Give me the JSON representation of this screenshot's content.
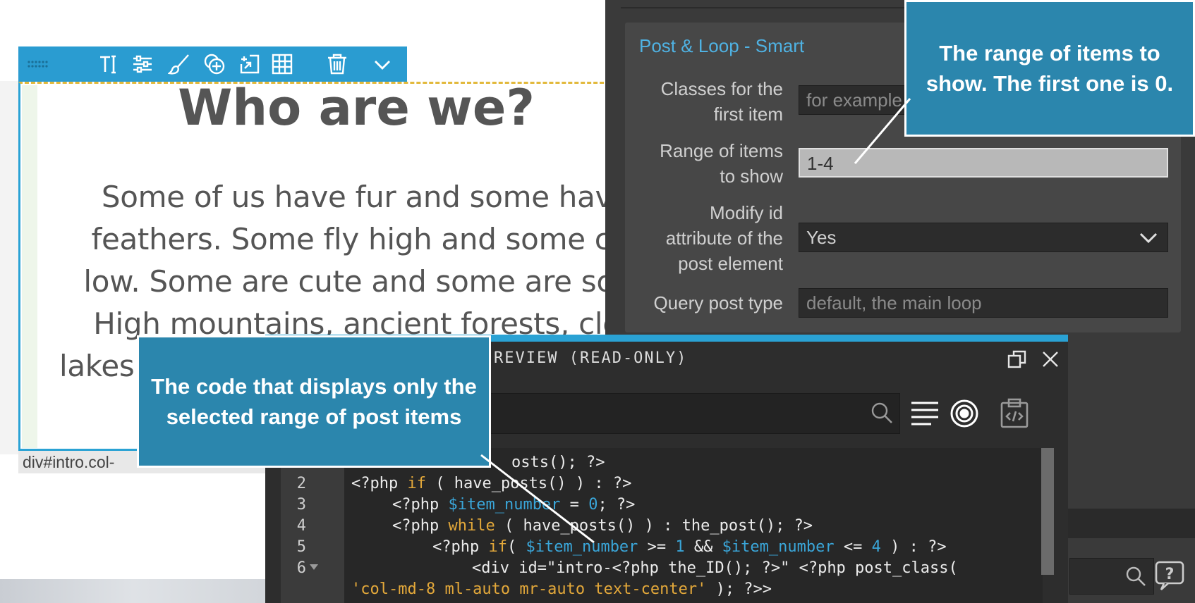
{
  "canvas": {
    "heading": "Who are we?",
    "body_lines": [
      "Some of us have fur and some hav",
      "feathers. Some fly high and some cr",
      "low. Some are cute and some are sca",
      "High mountains, ancient forests, cle",
      "lakes"
    ],
    "breadcrumb": "div#intro.col-",
    "toolbar_icons": [
      "drag-handle-icon",
      "text-icon",
      "sliders-icon",
      "brush-icon",
      "add-element-icon",
      "insert-icon",
      "grid-icon",
      "trash-icon",
      "chevron-down-icon"
    ]
  },
  "settings_panel": {
    "group_title": "Post & Loop - Smart",
    "fields": {
      "classes_first_item": {
        "label_line1": "Classes for the",
        "label_line2": "first item",
        "placeholder": "for example"
      },
      "range_of_items": {
        "label_line1": "Range of items",
        "label_line2": "to show",
        "value": "1-4"
      },
      "modify_id": {
        "label_line1": "Modify id",
        "label_line2": "attribute of the",
        "label_line3": "post element",
        "value": "Yes"
      },
      "query_post_type": {
        "label": "Query post type",
        "placeholder": "default, the main loop"
      }
    }
  },
  "code_preview": {
    "title": "REVIEW (READ-ONLY)",
    "line_numbers": [
      "2",
      "3",
      "4",
      "5",
      "6"
    ],
    "lines": {
      "l1_tail": "osts(); ?>",
      "l2": {
        "a": "<?php ",
        "b": "if",
        "c": " ( have_posts() ) : ?>"
      },
      "l3": {
        "a": "<?php ",
        "b": "$item_number",
        "c": " = ",
        "d": "0",
        "e": "; ?>"
      },
      "l4": {
        "a": "<?php ",
        "b": "while",
        "c": " ( have_posts() ) : the_post(); ?>"
      },
      "l5": {
        "a": "<?php ",
        "b": "if",
        "c": "( ",
        "d": "$item_number",
        "e": " >= ",
        "f": "1",
        "g": " && ",
        "h": "$item_number",
        "i": " <= ",
        "j": "4",
        "k": " ) : ?>"
      },
      "l6": "<div id=\"intro-<?php the_ID(); ?>\" <?php post_class(",
      "l7": {
        "a": "'col-md-8 ml-auto mr-auto text-center'",
        "b": " ); ?>>"
      }
    }
  },
  "callouts": {
    "range": {
      "line1": "The range of items to",
      "line2": "show. The first one is 0."
    },
    "code": {
      "line1": "The code that displays only the",
      "line2": "selected range of post items"
    }
  },
  "colors": {
    "accent": "#2a9cd1",
    "callout_bg": "#2b86ad",
    "panel_bg": "#3a3a3a",
    "keyword": "#e3a83a",
    "variable": "#3aa6d9"
  }
}
